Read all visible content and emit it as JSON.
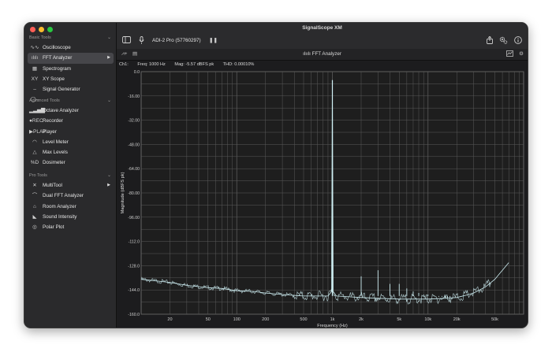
{
  "app": {
    "title": "SignalScope XM"
  },
  "sidebar": {
    "basic_tools": {
      "header": "Basic Tools",
      "items": [
        {
          "label": "Oscilloscope",
          "icon": "oscilloscope-icon",
          "glyph": "∿∿"
        },
        {
          "label": "FFT Analyzer",
          "icon": "fft-icon",
          "glyph": "ılılı",
          "selected": true,
          "has_arrow": true
        },
        {
          "label": "Spectrogram",
          "icon": "spectrogram-icon",
          "glyph": "▦"
        },
        {
          "label": "XY Scope",
          "icon": "xy-scope-icon",
          "glyph": "XY"
        },
        {
          "label": "Signal Generator",
          "icon": "signal-generator-icon",
          "glyph": "–◯–"
        }
      ]
    },
    "advanced_tools": {
      "header": "Advanced Tools",
      "items": [
        {
          "label": "Octave Analyzer",
          "icon": "octave-icon",
          "glyph": "▂▃▅▇"
        },
        {
          "label": "Recorder",
          "icon": "recorder-icon",
          "glyph": "●REC"
        },
        {
          "label": "Player",
          "icon": "player-icon",
          "glyph": "▶PLAY"
        },
        {
          "label": "Level Meter",
          "icon": "level-meter-icon",
          "glyph": "◠"
        },
        {
          "label": "Max Levels",
          "icon": "max-levels-icon",
          "glyph": "△"
        },
        {
          "label": "Dosimeter",
          "icon": "dosimeter-icon",
          "glyph": "%D"
        }
      ]
    },
    "pro_tools": {
      "header": "Pro Tools",
      "items": [
        {
          "label": "MultiTool",
          "icon": "multitool-icon",
          "glyph": "✕",
          "has_arrow": true
        },
        {
          "label": "Dual FFT Analyzer",
          "icon": "dual-fft-icon",
          "glyph": "⌒"
        },
        {
          "label": "Room Analyzer",
          "icon": "room-analyzer-icon",
          "glyph": "⌂"
        },
        {
          "label": "Sound Intensity",
          "icon": "sound-intensity-icon",
          "glyph": "◣"
        },
        {
          "label": "Polar Plot",
          "icon": "polar-plot-icon",
          "glyph": "◎"
        }
      ]
    }
  },
  "toolbar": {
    "device": "ADI-2 Pro (57760297)",
    "pause_glyph": "❚❚"
  },
  "subtoolbar": {
    "title": "FFT Analyzer",
    "title_glyph": "ılıılı"
  },
  "readout": {
    "channel": "Ch1:",
    "freq": "Freq: 1000 Hz",
    "mag": "Mag: -5.57 dBFS pk",
    "thd": "THD: 0.00010%"
  },
  "chart_data": {
    "type": "line",
    "xlabel": "Frequency (Hz)",
    "ylabel": "Magnitude (dBFS pk)",
    "x_scale": "log",
    "xlim": [
      10,
      100000
    ],
    "ylim": [
      -160,
      0
    ],
    "x_tick_labels": [
      "20",
      "50",
      "100",
      "200",
      "500",
      "1k",
      "2k",
      "5k",
      "10k",
      "20k",
      "50k"
    ],
    "x_tick_values": [
      20,
      50,
      100,
      200,
      500,
      1000,
      2000,
      5000,
      10000,
      20000,
      50000
    ],
    "y_tick_labels": [
      "0.0",
      "-16.00",
      "-32.00",
      "-48.00",
      "-64.00",
      "-80.00",
      "-96.00",
      "-112.0",
      "-128.0",
      "-144.0",
      "-160.0"
    ],
    "y_tick_values": [
      0,
      -16,
      -32,
      -48,
      -64,
      -80,
      -96,
      -112,
      -128,
      -144,
      -160
    ],
    "grid": true,
    "series": [
      {
        "color": "#cfeff3",
        "points": [
          [
            10,
            -137
          ],
          [
            20,
            -139
          ],
          [
            30,
            -141
          ],
          [
            50,
            -142.5
          ],
          [
            70,
            -143
          ],
          [
            100,
            -144.5
          ],
          [
            150,
            -145
          ],
          [
            200,
            -146
          ],
          [
            300,
            -147
          ],
          [
            500,
            -148
          ],
          [
            700,
            -148
          ],
          [
            900,
            -148
          ],
          [
            980,
            -145
          ],
          [
            1000,
            -5.57
          ],
          [
            1020,
            -145
          ],
          [
            1100,
            -148
          ],
          [
            1500,
            -148.5
          ],
          [
            2000,
            -149
          ],
          [
            3000,
            -149.5
          ],
          [
            5000,
            -150
          ],
          [
            10000,
            -150
          ],
          [
            15000,
            -149.5
          ],
          [
            20000,
            -149
          ],
          [
            25000,
            -147.5
          ],
          [
            30000,
            -146
          ],
          [
            40000,
            -142
          ],
          [
            50000,
            -137
          ],
          [
            60000,
            -131
          ],
          [
            70000,
            -126
          ]
        ],
        "harmonics": [
          [
            2000,
            -135
          ],
          [
            3000,
            -131
          ],
          [
            4000,
            -140
          ],
          [
            5000,
            -140
          ],
          [
            6000,
            -143
          ],
          [
            7000,
            -145
          ],
          [
            8000,
            -146
          ],
          [
            9000,
            -147
          ],
          [
            10000,
            -147
          ],
          [
            11000,
            -148
          ],
          [
            12000,
            -148
          ],
          [
            13000,
            -148.5
          ],
          [
            14000,
            -148.5
          ],
          [
            15000,
            -149
          ],
          [
            16000,
            -149
          ],
          [
            17000,
            -149
          ]
        ]
      }
    ]
  },
  "colors": {
    "trace": "#cfeff3",
    "grid": "#5a5a5a",
    "plot_bg": "#1e1e1e",
    "selected_item": "#46464a"
  }
}
